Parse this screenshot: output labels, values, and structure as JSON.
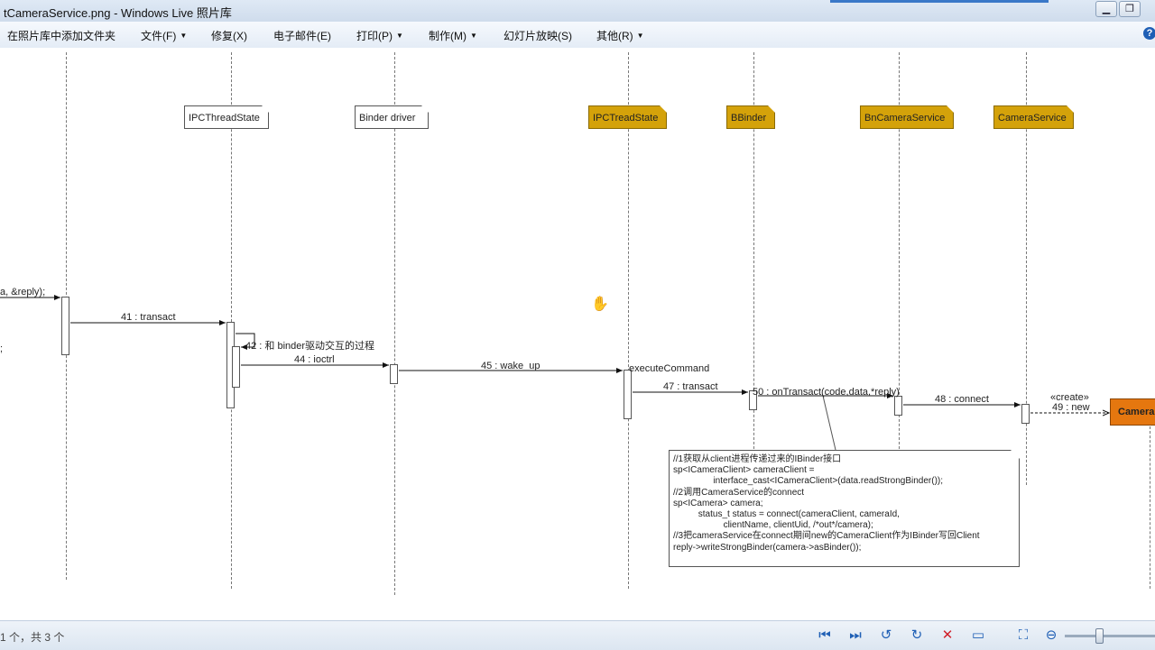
{
  "window": {
    "title": "tCameraService.png - Windows Live 照片库"
  },
  "menu": {
    "items": [
      {
        "label": "在照片库中添加文件夹"
      },
      {
        "label": "文件(F)",
        "dropdown": true
      },
      {
        "label": "修复(X)"
      },
      {
        "label": "电子邮件(E)"
      },
      {
        "label": "打印(P)",
        "dropdown": true
      },
      {
        "label": "制作(M)",
        "dropdown": true
      },
      {
        "label": "幻灯片放映(S)"
      },
      {
        "label": "其他(R)",
        "dropdown": true
      }
    ],
    "help_icon": "?"
  },
  "diagram": {
    "objects": [
      {
        "label": "IPCThreadState"
      },
      {
        "label": "Binder driver"
      },
      {
        "label": "IPCTreadState"
      },
      {
        "label": "BBinder"
      },
      {
        "label": "BnCameraService"
      },
      {
        "label": "CameraService"
      },
      {
        "label": "Camera"
      }
    ],
    "messages": {
      "m40": "a, &reply);",
      "m41": "41 : transact",
      "m42": "42 : 和 binder驱动交互的过程",
      "m44": "44 : ioctrl",
      "m45": "45 : wake_up",
      "m46": "executeCommand",
      "m47": "47 : transact",
      "m50": "50 : onTransact(code,data,*reply)",
      "m48": "48 : connect",
      "m49_stereo": "«create»",
      "m49": "49 : new",
      "edge_semicolon": ";"
    },
    "note_lines": [
      "//1获取从client进程传递过来的IBinder接口",
      "sp<ICameraClient> cameraClient =",
      "                interface_cast<ICameraClient>(data.readStrongBinder());",
      "//2调用CameraService的connect",
      "sp<ICamera> camera;",
      "          status_t status = connect(cameraClient, cameraId,",
      "                    clientName, clientUid, /*out*/camera);",
      "//3把cameraService在connect期间new的CameraClient作为IBinder写回Client",
      "reply->writeStrongBinder(camera->asBinder());"
    ]
  },
  "status": {
    "text": "1 个，共 3 个"
  },
  "colors": {
    "gold": "#d4a20a",
    "orange": "#e5770f"
  }
}
